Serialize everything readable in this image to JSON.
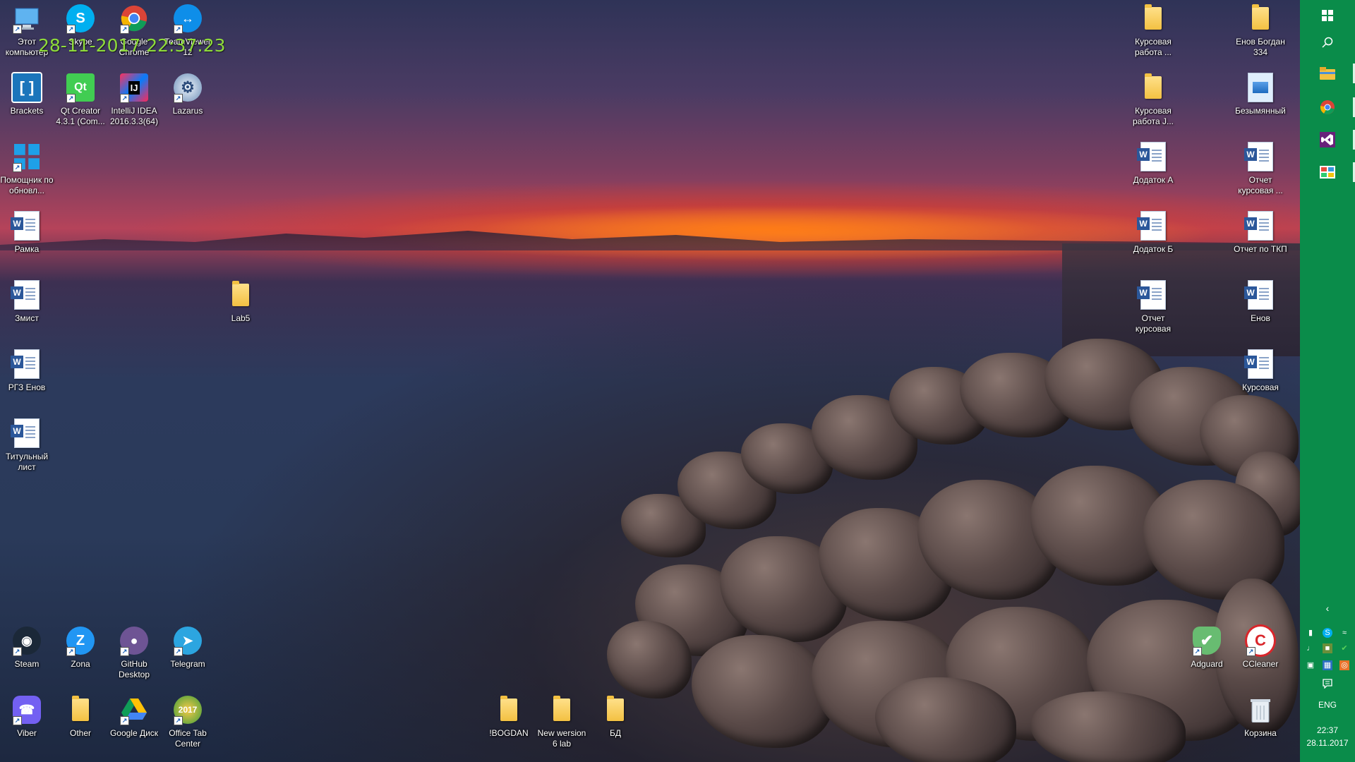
{
  "desktop": {
    "datestamp": "28-11-2017 22:37:23",
    "icons": [
      {
        "id": "this-pc",
        "label": "Этот компьютер",
        "kind": "pc"
      },
      {
        "id": "skype",
        "label": "Skype",
        "kind": "skype"
      },
      {
        "id": "google-chrome",
        "label": "Google Chrome",
        "kind": "chrome"
      },
      {
        "id": "teamviewer",
        "label": "TeamViewer 12",
        "kind": "teamviewer"
      },
      {
        "id": "brackets",
        "label": "Brackets",
        "kind": "brackets"
      },
      {
        "id": "qt-creator",
        "label": "Qt Creator 4.3.1 (Com...",
        "kind": "qt"
      },
      {
        "id": "intellij-idea",
        "label": "IntelliJ IDEA 2016.3.3(64)",
        "kind": "intellij"
      },
      {
        "id": "lazarus",
        "label": "Lazarus",
        "kind": "lazarus"
      },
      {
        "id": "update-assistant",
        "label": "Помощник по обновл...",
        "kind": "windows"
      },
      {
        "id": "ramka",
        "label": "Рамка",
        "kind": "word"
      },
      {
        "id": "zmist",
        "label": "Змист",
        "kind": "word"
      },
      {
        "id": "lab5",
        "label": "Lab5",
        "kind": "folder"
      },
      {
        "id": "rgz-enov",
        "label": "РГЗ Енов",
        "kind": "word"
      },
      {
        "id": "title-page",
        "label": "Титульный лист",
        "kind": "word"
      },
      {
        "id": "steam",
        "label": "Steam",
        "kind": "steam"
      },
      {
        "id": "zona",
        "label": "Zona",
        "kind": "zona"
      },
      {
        "id": "github-desktop",
        "label": "GitHub Desktop",
        "kind": "github"
      },
      {
        "id": "telegram",
        "label": "Telegram",
        "kind": "telegram"
      },
      {
        "id": "viber",
        "label": "Viber",
        "kind": "viber"
      },
      {
        "id": "other",
        "label": "Other",
        "kind": "folder"
      },
      {
        "id": "google-disk",
        "label": "Google Диск",
        "kind": "gdrive"
      },
      {
        "id": "office-tab-center",
        "label": "Office Tab Center",
        "kind": "officetab"
      },
      {
        "id": "bogdan",
        "label": "!BOGDAN",
        "kind": "folder"
      },
      {
        "id": "new-version-6-lab",
        "label": "New wersion 6 lab",
        "kind": "folder"
      },
      {
        "id": "bd",
        "label": "БД",
        "kind": "folder"
      },
      {
        "id": "kursovaya-1",
        "label": "Курсовая работа ...",
        "kind": "folder"
      },
      {
        "id": "enov-bogdan",
        "label": "Енов Богдан 334",
        "kind": "folder"
      },
      {
        "id": "kursovaya-2",
        "label": "Курсовая работа J...",
        "kind": "folder"
      },
      {
        "id": "untitled",
        "label": "Безымянный",
        "kind": "image"
      },
      {
        "id": "dodatok-a",
        "label": "Додаток А",
        "kind": "word"
      },
      {
        "id": "report-kursovaya-1",
        "label": "Отчет курсовая ...",
        "kind": "word"
      },
      {
        "id": "dodatok-b",
        "label": "Додаток Б",
        "kind": "word"
      },
      {
        "id": "report-tkp",
        "label": "Отчет по ТКП",
        "kind": "word"
      },
      {
        "id": "report-kursovaya-2",
        "label": "Отчет курсовая",
        "kind": "word"
      },
      {
        "id": "enov",
        "label": "Енов",
        "kind": "word"
      },
      {
        "id": "kursovaya-doc",
        "label": "Курсовая",
        "kind": "word"
      },
      {
        "id": "adguard",
        "label": "Adguard",
        "kind": "adguard"
      },
      {
        "id": "ccleaner",
        "label": "CCleaner",
        "kind": "ccleaner"
      },
      {
        "id": "recycle-bin",
        "label": "Корзина",
        "kind": "bin"
      }
    ]
  },
  "taskbar": {
    "accent": "#0a8c4a",
    "buttons": [
      {
        "id": "start",
        "icon": "windows-logo-icon"
      },
      {
        "id": "search",
        "icon": "search-icon"
      },
      {
        "id": "file-explorer",
        "icon": "folder-icon"
      },
      {
        "id": "chrome",
        "icon": "chrome-icon"
      },
      {
        "id": "visual-studio",
        "icon": "visual-studio-icon"
      },
      {
        "id": "app-colorful",
        "icon": "app-icon"
      }
    ],
    "language": "ENG",
    "clock_time": "22:37",
    "clock_date": "28.11.2017"
  }
}
